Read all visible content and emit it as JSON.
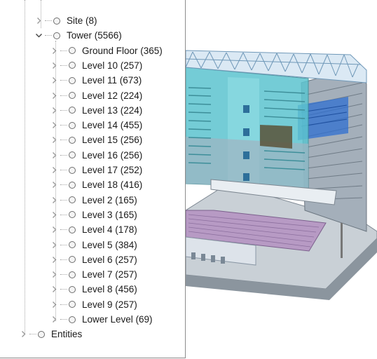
{
  "tree": {
    "nodes": [
      {
        "label": "Site (8)",
        "level": 1,
        "expanded": false
      },
      {
        "label": "Tower (5566)",
        "level": 1,
        "expanded": true
      },
      {
        "label": "Ground Floor (365)",
        "level": 2,
        "expanded": false
      },
      {
        "label": "Level 10 (257)",
        "level": 2,
        "expanded": false
      },
      {
        "label": "Level 11 (673)",
        "level": 2,
        "expanded": false
      },
      {
        "label": "Level 12 (224)",
        "level": 2,
        "expanded": false
      },
      {
        "label": "Level 13 (224)",
        "level": 2,
        "expanded": false
      },
      {
        "label": "Level 14 (455)",
        "level": 2,
        "expanded": false
      },
      {
        "label": "Level 15 (256)",
        "level": 2,
        "expanded": false
      },
      {
        "label": "Level 16 (256)",
        "level": 2,
        "expanded": false
      },
      {
        "label": "Level 17 (252)",
        "level": 2,
        "expanded": false
      },
      {
        "label": "Level 18 (416)",
        "level": 2,
        "expanded": false
      },
      {
        "label": "Level 2 (165)",
        "level": 2,
        "expanded": false
      },
      {
        "label": "Level 3 (165)",
        "level": 2,
        "expanded": false
      },
      {
        "label": "Level 4 (178)",
        "level": 2,
        "expanded": false
      },
      {
        "label": "Level 5 (384)",
        "level": 2,
        "expanded": false
      },
      {
        "label": "Level 6 (257)",
        "level": 2,
        "expanded": false
      },
      {
        "label": "Level 7 (257)",
        "level": 2,
        "expanded": false
      },
      {
        "label": "Level 8 (456)",
        "level": 2,
        "expanded": false
      },
      {
        "label": "Level 9 (257)",
        "level": 2,
        "expanded": false
      },
      {
        "label": "Lower Level (69)",
        "level": 2,
        "expanded": false
      },
      {
        "label": "Entities",
        "level": 0,
        "expanded": false
      }
    ],
    "icons": {
      "collapsed": "chevron-right-icon",
      "expanded": "chevron-down-icon",
      "node": "radio-circle-icon"
    }
  },
  "viewport": {
    "content": "3d-building-model",
    "colors": {
      "tower_cyan": "#5cc4cf",
      "tower_gray": "#9aa8b4",
      "highlight_blue": "#2f6fd0",
      "roof_purple": "#b79ac4",
      "truss": "#7fa9c8"
    }
  }
}
